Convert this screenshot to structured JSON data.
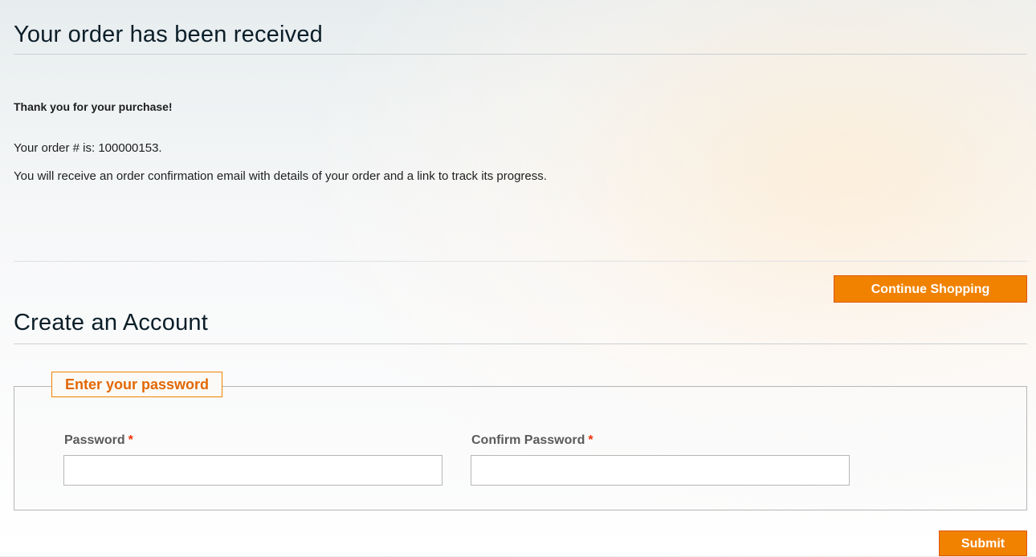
{
  "order": {
    "title": "Your order has been received",
    "thanks": "Thank you for your purchase!",
    "order_number_line": "Your order # is: 100000153.",
    "email_line": "You will receive an order confirmation email with details of your order and a link to track its progress.",
    "continue_label": "Continue Shopping"
  },
  "account": {
    "title": "Create an Account",
    "legend": "Enter your password",
    "password_label": "Password",
    "confirm_label": "Confirm Password",
    "required_mark": "*",
    "password_value": "",
    "confirm_value": "",
    "submit_label": "Submit"
  },
  "colors": {
    "accent": "#f18200",
    "accent_border": "#de5400",
    "legend_text": "#e26703",
    "required": "#eb340a"
  }
}
